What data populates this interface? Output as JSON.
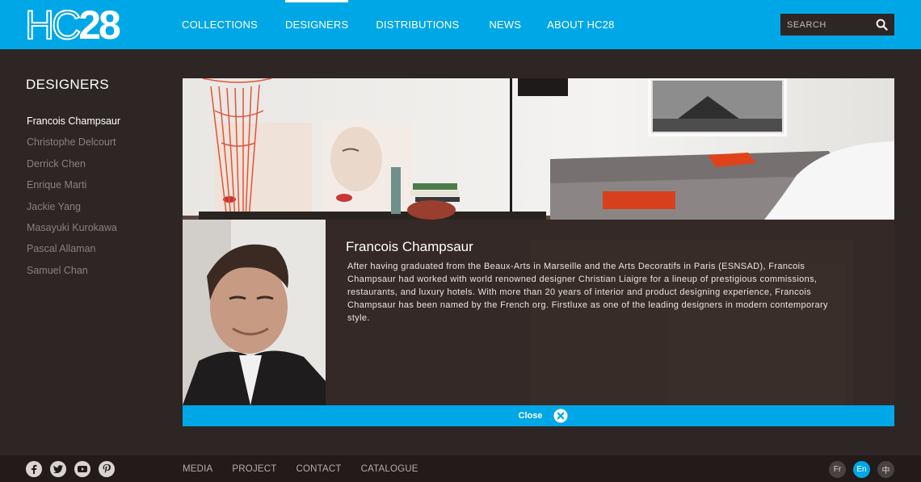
{
  "brand": {
    "logo_outline": "HC",
    "logo_solid": "28"
  },
  "nav": {
    "items": [
      {
        "label": "COLLECTIONS",
        "active": false
      },
      {
        "label": "DESIGNERS",
        "active": true
      },
      {
        "label": "DISTRIBUTIONS",
        "active": false
      },
      {
        "label": "NEWS",
        "active": false
      },
      {
        "label": "ABOUT HC28",
        "active": false
      }
    ]
  },
  "search": {
    "placeholder": "SEARCH",
    "value": "",
    "icon": "search-icon"
  },
  "sidebar": {
    "title": "DESIGNERS",
    "items": [
      {
        "label": "Francois Champsaur",
        "active": true
      },
      {
        "label": "Christophe Delcourt",
        "active": false
      },
      {
        "label": "Derrick Chen",
        "active": false
      },
      {
        "label": "Enrique Marti",
        "active": false
      },
      {
        "label": "Jackie Yang",
        "active": false
      },
      {
        "label": "Masayuki Kurokawa",
        "active": false
      },
      {
        "label": "Pascal Allaman",
        "active": false
      },
      {
        "label": "Samuel Chan",
        "active": false
      }
    ]
  },
  "designer": {
    "name": "Francois Champsaur",
    "bio": "After having graduated from the Beaux-Arts in Marseille and the Arts Decoratifs in Paris (ESNSAD), Francois Champsaur had worked with world renowned designer Christian Liaigre for a lineup of prestigious commissions, restaurants, and luxury hotels. With more than 20 years of interior and product designing experience, Francois Champsaur has been named by the French org. Firstluxe as one of the leading designers in modern contemporary style."
  },
  "close": {
    "label": "Close",
    "icon": "close-circle-icon"
  },
  "footer": {
    "social": [
      "facebook-icon",
      "twitter-icon",
      "youtube-icon",
      "pinterest-icon"
    ],
    "links": [
      "MEDIA",
      "PROJECT",
      "CONTACT",
      "CATALOGUE"
    ],
    "languages": [
      {
        "label": "Fr",
        "active": false
      },
      {
        "label": "En",
        "active": true
      },
      {
        "label": "中",
        "active": false
      }
    ]
  },
  "colors": {
    "accent": "#00a7e7",
    "background": "#2e2624",
    "footer": "#221b19",
    "muted_text": "#8a817e"
  }
}
